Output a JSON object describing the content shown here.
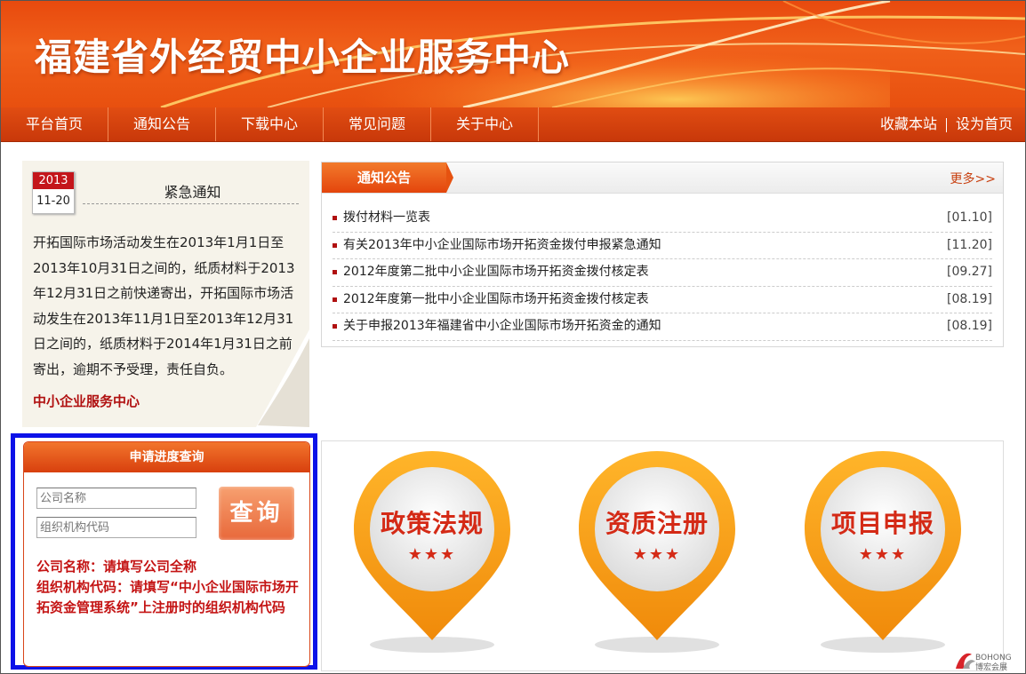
{
  "header": {
    "site_title": "福建省外经贸中小企业服务中心"
  },
  "nav": {
    "items": [
      "平台首页",
      "通知公告",
      "下载中心",
      "常见问题",
      "关于中心"
    ],
    "bookmark": "收藏本站",
    "set_home": "设为首页"
  },
  "notice": {
    "date_year": "2013",
    "date_day": "11-20",
    "title": "紧急通知",
    "body": "开拓国际市场活动发生在2013年1月1日至2013年10月31日之间的，纸质材料于2013年12月31日之前快递寄出，开拓国际市场活动发生在2013年11月1日至2013年12月31日之间的，纸质材料于2014年1月31日之前寄出，逾期不予受理，责任自负。",
    "signature": "中小企业服务中心"
  },
  "announcements": {
    "tab_label": "通知公告",
    "more_label": "更多>>",
    "items": [
      {
        "title": "拨付材料一览表",
        "date": "[01.10]"
      },
      {
        "title": "有关2013年中小企业国际市场开拓资金拨付申报紧急通知",
        "date": "[11.20]"
      },
      {
        "title": "2012年度第二批中小企业国际市场开拓资金拨付核定表",
        "date": "[09.27]"
      },
      {
        "title": "2012年度第一批中小企业国际市场开拓资金拨付核定表",
        "date": "[08.19]"
      },
      {
        "title": "关于申报2013年福建省中小企业国际市场开拓资金的通知",
        "date": "[08.19]"
      }
    ]
  },
  "query": {
    "header": "申请进度查询",
    "company_placeholder": "公司名称",
    "org_code_placeholder": "组织机构代码",
    "button_label": "查询",
    "help_company": "公司名称：请填写公司全称",
    "help_org": "组织机构代码：请填写“中小企业国际市场开拓资金管理系统”上注册时的组织机构代码"
  },
  "quick_links": [
    {
      "label": "政策法规",
      "stars": "★★★"
    },
    {
      "label": "资质注册",
      "stars": "★★★"
    },
    {
      "label": "项目申报",
      "stars": "★★★"
    }
  ],
  "logo": {
    "line1": "BOHONG",
    "line2": "博宏会展"
  },
  "colors": {
    "brand_orange": "#e8500f",
    "dark_red": "#b01010",
    "highlight_blue": "#0d12e8",
    "pin_orange": "#f49a10"
  }
}
